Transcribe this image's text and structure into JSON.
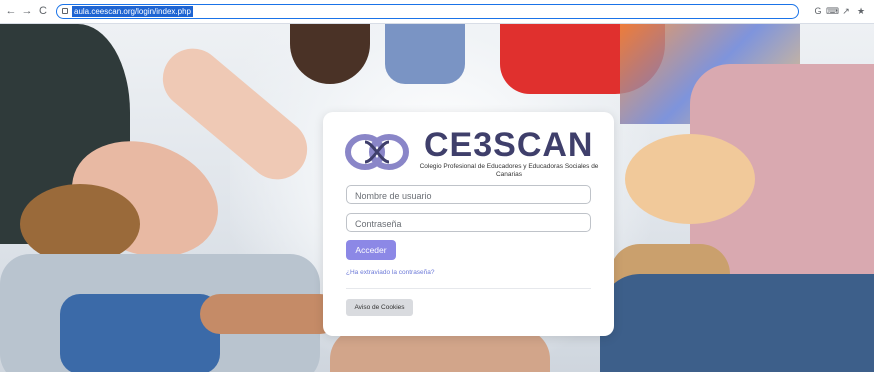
{
  "browser": {
    "url": "aula.ceescan.org/login/index.php",
    "back_glyph": "←",
    "forward_glyph": "→",
    "reload_glyph": "C",
    "ext_icons": [
      "G",
      "⌨",
      "↗",
      "★"
    ]
  },
  "login": {
    "brand": "CE3SCAN",
    "subtitle": "Colegio Profesional de Educadores y Educadoras Sociales de Canarias",
    "username_placeholder": "Nombre de usuario",
    "password_placeholder": "Contraseña",
    "submit_label": "Acceder",
    "forgot_link": "¿Ha extraviado la contraseña?",
    "cookies_label": "Aviso de Cookies"
  },
  "colors": {
    "brand": "#3f3f6b",
    "logo_mark": "#8a86c8",
    "primary_button": "#8c88e6",
    "link": "#6d7ad8"
  }
}
